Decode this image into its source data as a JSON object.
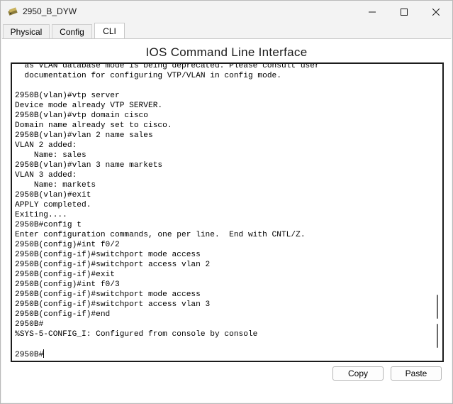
{
  "window": {
    "title": "2950_B_DYW",
    "app_icon": "cisco-device-icon",
    "controls": [
      "minimize-icon",
      "maximize-icon",
      "close-icon"
    ]
  },
  "tabs": [
    {
      "label": "Physical",
      "active": false
    },
    {
      "label": "Config",
      "active": false
    },
    {
      "label": "CLI",
      "active": true
    }
  ],
  "heading": "IOS Command Line Interface",
  "terminal": {
    "lines": [
      "  as VLAN database mode is being deprecated. Please consult user",
      "  documentation for configuring VTP/VLAN in config mode.",
      "",
      "2950B(vlan)#vtp server",
      "Device mode already VTP SERVER.",
      "2950B(vlan)#vtp domain cisco",
      "Domain name already set to cisco.",
      "2950B(vlan)#vlan 2 name sales",
      "VLAN 2 added:",
      "    Name: sales",
      "2950B(vlan)#vlan 3 name markets",
      "VLAN 3 added:",
      "    Name: markets",
      "2950B(vlan)#exit",
      "APPLY completed.",
      "Exiting....",
      "2950B#config t",
      "Enter configuration commands, one per line.  End with CNTL/Z.",
      "2950B(config)#int f0/2",
      "2950B(config-if)#switchport mode access",
      "2950B(config-if)#switchport access vlan 2",
      "2950B(config-if)#exit",
      "2950B(config)#int f0/3",
      "2950B(config-if)#switchport mode access",
      "2950B(config-if)#switchport access vlan 3",
      "2950B(config-if)#end",
      "2950B#",
      "%SYS-5-CONFIG_I: Configured from console by console",
      ""
    ],
    "prompt": "2950B#"
  },
  "buttons": {
    "copy": "Copy",
    "paste": "Paste"
  }
}
